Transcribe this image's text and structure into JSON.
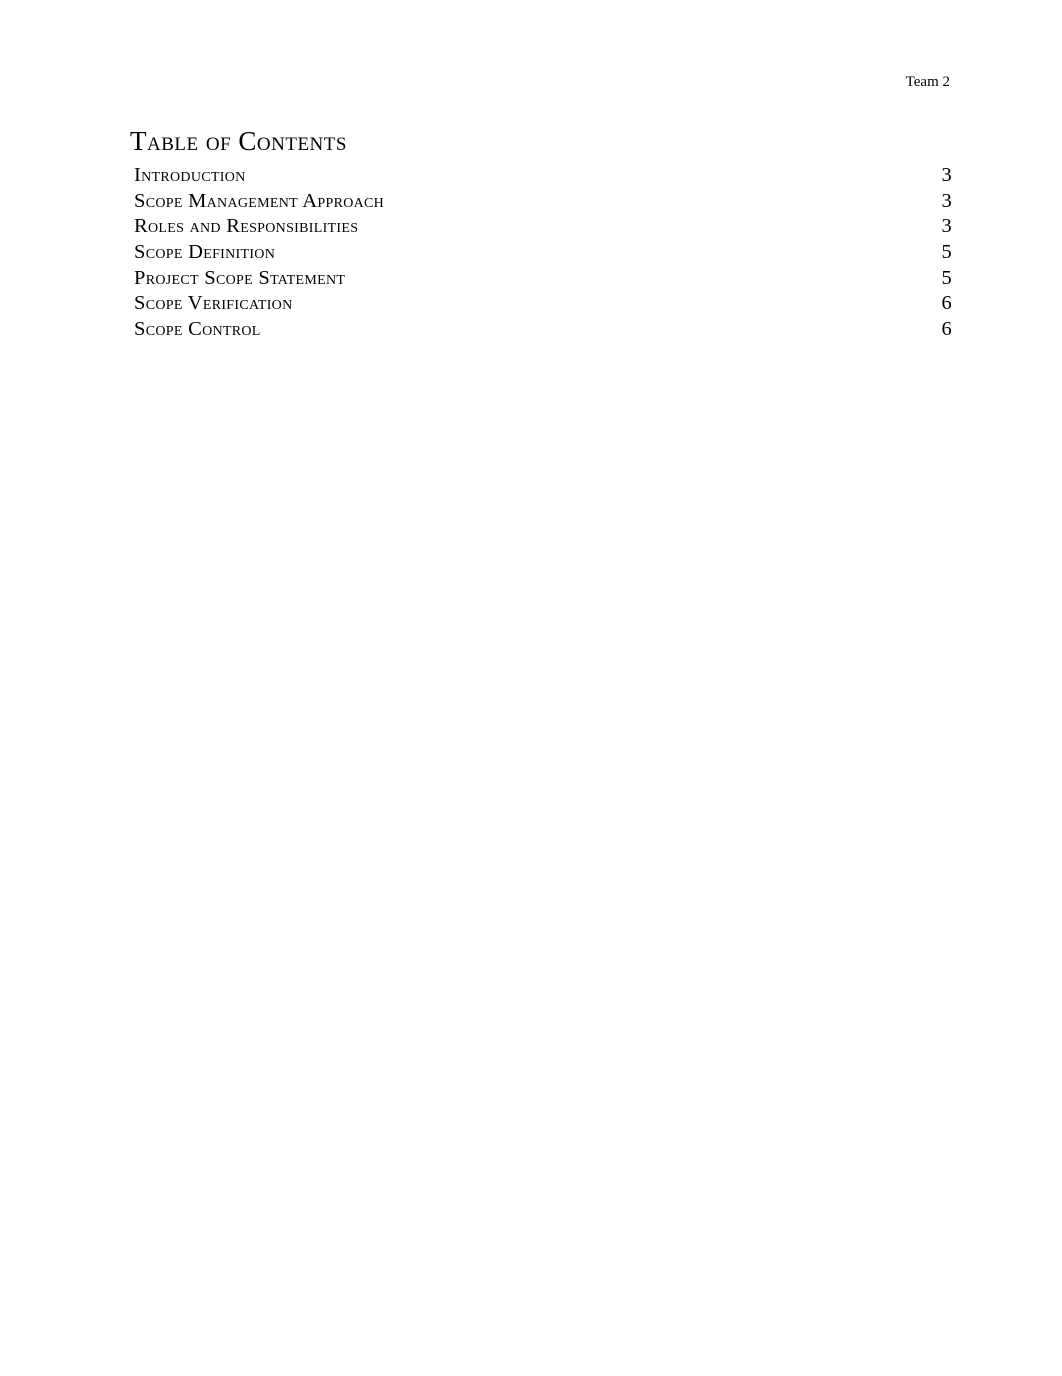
{
  "header": {
    "label": "Team 2"
  },
  "toc": {
    "title": "Table of Contents",
    "entries": [
      {
        "label": "Introduction",
        "page": "3"
      },
      {
        "label": "Scope Management Approach",
        "page": "3"
      },
      {
        "label": "Roles and Responsibilities",
        "page": "3"
      },
      {
        "label": "Scope Definition",
        "page": "5"
      },
      {
        "label": "Project Scope Statement",
        "page": "5"
      },
      {
        "label": "Scope Verification",
        "page": "6"
      },
      {
        "label": "Scope Control",
        "page": "6"
      }
    ]
  }
}
